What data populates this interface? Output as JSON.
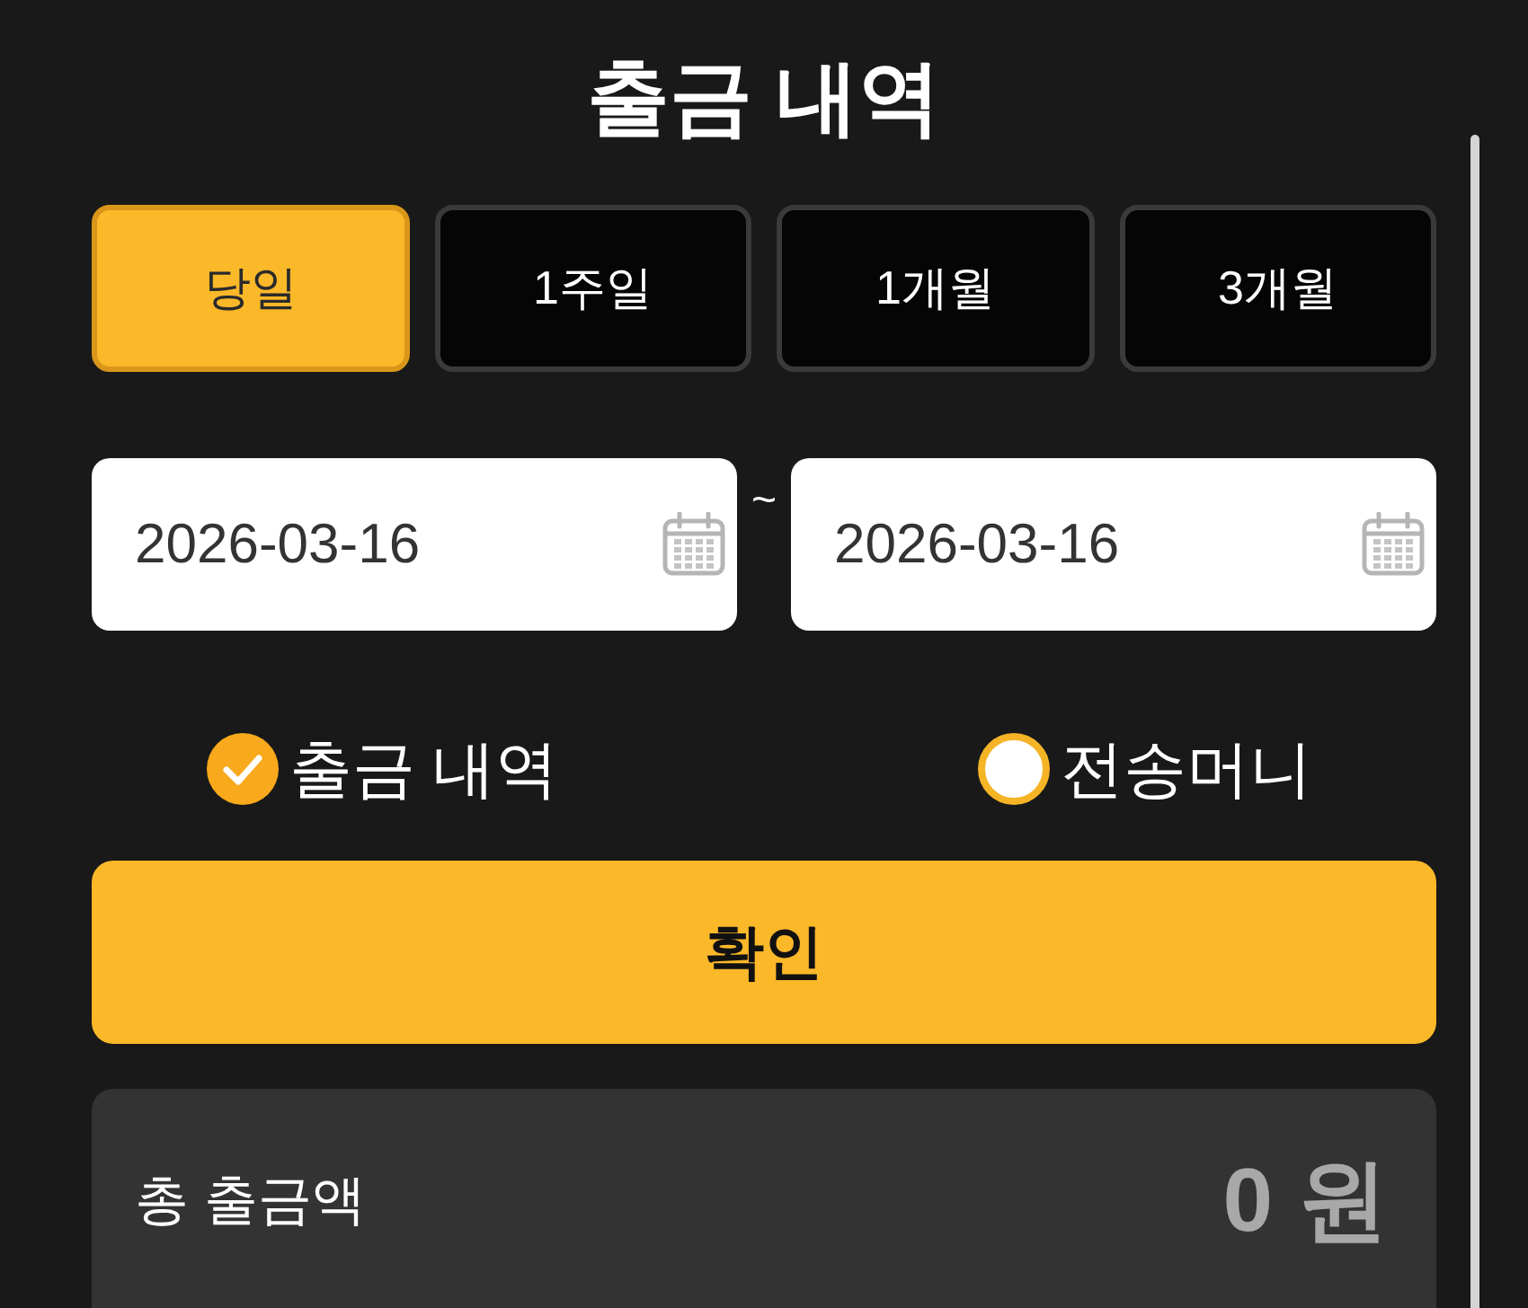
{
  "title": "출금 내역",
  "period_tabs": [
    {
      "label": "당일",
      "selected": true
    },
    {
      "label": "1주일",
      "selected": false
    },
    {
      "label": "1개월",
      "selected": false
    },
    {
      "label": "3개월",
      "selected": false
    }
  ],
  "date_range": {
    "start": {
      "value": "2026-03-16"
    },
    "separator": "~",
    "end": {
      "value": "2026-03-16"
    }
  },
  "record_types": [
    {
      "label": "출금 내역",
      "selected": true
    },
    {
      "label": "전송머니",
      "selected": false
    }
  ],
  "confirm_button": "확인",
  "summary": {
    "label": "총 출금액",
    "amount": "0 원"
  }
}
